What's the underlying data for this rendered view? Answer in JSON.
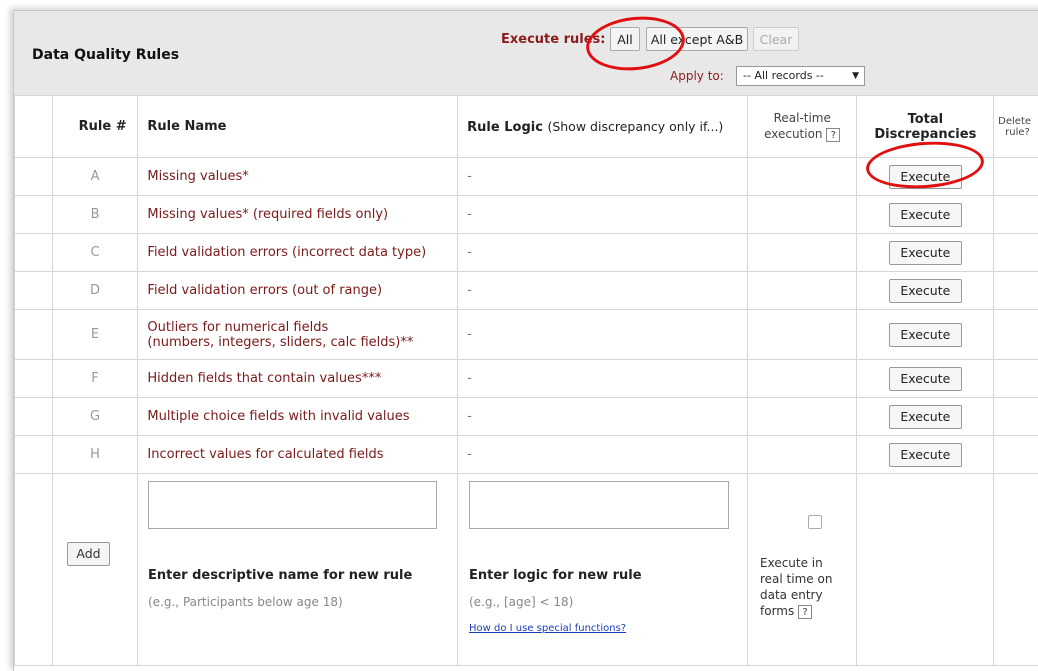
{
  "header": {
    "title": "Data Quality Rules",
    "execute_label": "Execute rules:",
    "btn_all": "All",
    "btn_except": "All except A&B",
    "btn_clear": "Clear",
    "apply_to_label": "Apply to:",
    "apply_to_value": "-- All records --"
  },
  "columns": {
    "rule_num": "Rule #",
    "rule_name": "Rule Name",
    "rule_logic": "Rule Logic",
    "rule_logic_note": "(Show discrepancy only if...)",
    "realtime_l1": "Real-time",
    "realtime_l2": "execution",
    "total_l1": "Total",
    "total_l2": "Discrepancies",
    "delete_l1": "Delete",
    "delete_l2": "rule?"
  },
  "rules": [
    {
      "letter": "A",
      "name": "Missing values*",
      "logic": "-",
      "action": "Execute"
    },
    {
      "letter": "B",
      "name": "Missing values* (required fields only)",
      "logic": "-",
      "action": "Execute"
    },
    {
      "letter": "C",
      "name": "Field validation errors (incorrect data type)",
      "logic": "-",
      "action": "Execute"
    },
    {
      "letter": "D",
      "name": "Field validation errors (out of range)",
      "logic": "-",
      "action": "Execute"
    },
    {
      "letter": "E",
      "name_l1": "Outliers for numerical fields",
      "name_l2": "(numbers, integers, sliders, calc fields)**",
      "logic": "-",
      "action": "Execute"
    },
    {
      "letter": "F",
      "name": "Hidden fields that contain values***",
      "logic": "-",
      "action": "Execute"
    },
    {
      "letter": "G",
      "name": "Multiple choice fields with invalid values",
      "logic": "-",
      "action": "Execute"
    },
    {
      "letter": "H",
      "name": "Incorrect values for calculated fields",
      "logic": "-",
      "action": "Execute"
    }
  ],
  "new_rule": {
    "add_label": "Add",
    "name_caption": "Enter descriptive name for new rule",
    "name_example": "(e.g., Participants below age 18)",
    "logic_caption": "Enter logic for new rule",
    "logic_example": "(e.g., [age] < 18)",
    "logic_help_link": "How do I use special functions?",
    "realtime_l1": "Execute in",
    "realtime_l2": "real time on",
    "realtime_l3": "data entry",
    "realtime_l4": "forms"
  },
  "icons": {
    "help": "?",
    "dropdown": "▼"
  }
}
